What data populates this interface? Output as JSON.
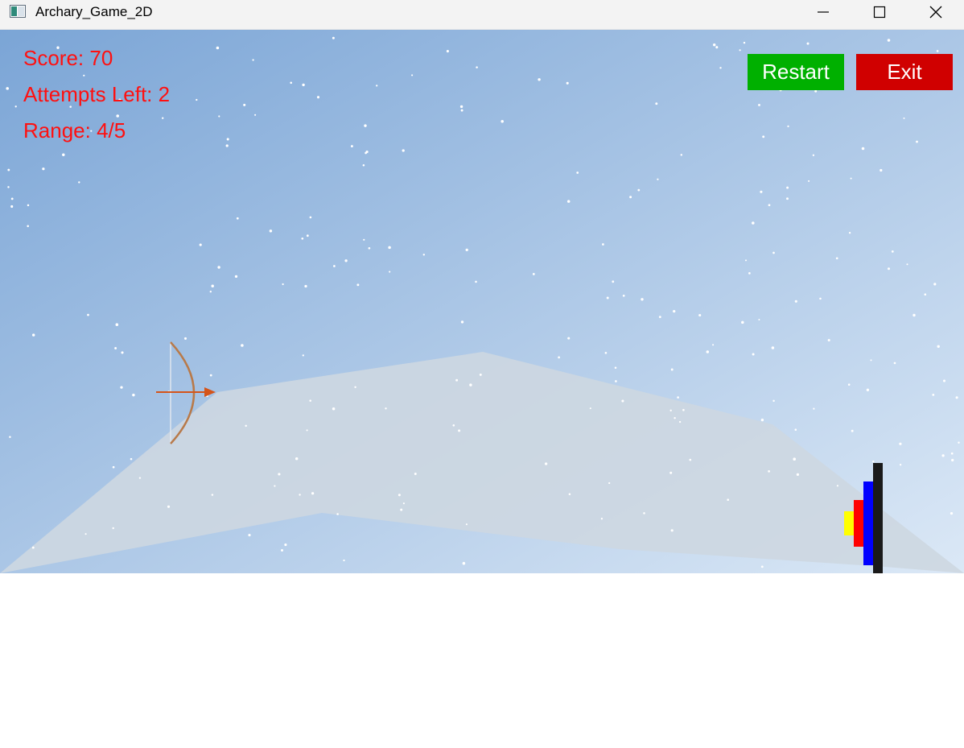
{
  "window": {
    "title": "Archary_Game_2D"
  },
  "hud": {
    "score": "Score: 70",
    "attempts": "Attempts Left: 2",
    "range": "Range: 4/5",
    "text_color": "#ff1010"
  },
  "buttons": {
    "restart_label": "Restart",
    "exit_label": "Exit",
    "restart_color": "#00b000",
    "exit_color": "#d00000"
  },
  "scene": {
    "sky_top_color": "#7ba5d6",
    "sky_bottom_color": "#dbe8f6",
    "mountain_color": "#cdd7e1",
    "target_ring_colors": [
      "#ffff00",
      "#ff0000",
      "#0000ff",
      "#1a1a1a"
    ],
    "bow_color": "#b87a4a",
    "arrow_color": "#d4541a"
  },
  "icons": {
    "app": "app-icon",
    "minimize": "minimize-icon",
    "maximize": "maximize-icon",
    "close": "close-icon"
  }
}
